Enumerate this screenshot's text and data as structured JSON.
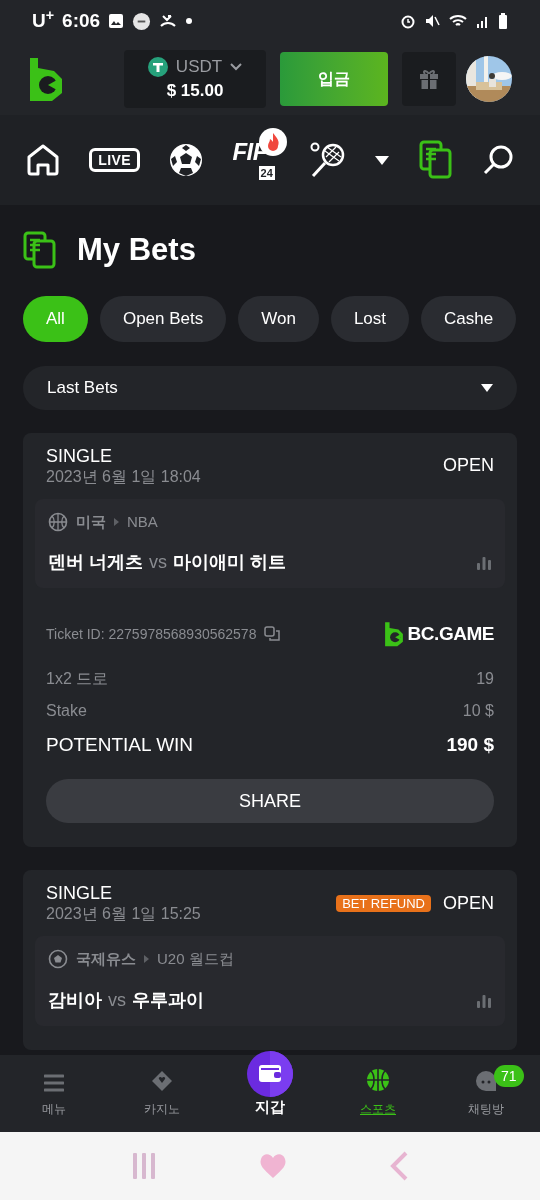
{
  "status_bar": {
    "carrier": "U$^{+}$",
    "time": "6:06"
  },
  "header": {
    "currency": "USDT",
    "balance": "$ 15.00",
    "deposit_button": "입금"
  },
  "sport_nav": [
    {
      "kind": "home",
      "selected": false
    },
    {
      "kind": "live",
      "label": "LIVE",
      "selected": false
    },
    {
      "kind": "soccer",
      "selected": false
    },
    {
      "kind": "fifa",
      "label": "FIF",
      "sub": "24",
      "hot": true,
      "selected": false
    },
    {
      "kind": "tennis",
      "selected": false
    },
    {
      "kind": "more",
      "selected": false
    },
    {
      "kind": "bets",
      "selected": true
    },
    {
      "kind": "search",
      "selected": false
    }
  ],
  "page_title": "My Bets",
  "filters": [
    {
      "label": "All",
      "selected": true
    },
    {
      "label": "Open Bets",
      "selected": false
    },
    {
      "label": "Won",
      "selected": false
    },
    {
      "label": "Lost",
      "selected": false
    },
    {
      "label": "Cashe",
      "selected": false
    }
  ],
  "period_dropdown": "Last Bets",
  "bets": [
    {
      "type": "SINGLE",
      "date": "2023년 6월 1일 18:04",
      "status": "OPEN",
      "kind": "basketball",
      "country": "미국",
      "league": "NBA",
      "home": "덴버 너게츠",
      "vs": "vs",
      "away": "마이애미 히트",
      "ticket": "Ticket ID: 2275978568930562578",
      "brand": "BC.GAME",
      "lines": [
        {
          "label": "1x2 드로",
          "value": "19"
        },
        {
          "label": "Stake",
          "value": "10 $"
        }
      ],
      "potential": {
        "label": "POTENTIAL WIN",
        "value": "190 $"
      },
      "share": "SHARE"
    },
    {
      "type": "SINGLE",
      "date": "2023년 6월 1일 15:25",
      "badge": "BET REFUND",
      "status": "OPEN",
      "kind": "soccer",
      "country": "국제유스",
      "league": "U20 월드컵",
      "home": "감비아",
      "vs": "vs",
      "away": "우루과이"
    }
  ],
  "bottom_nav": [
    {
      "kind": "menu",
      "label": "메뉴",
      "selected": false
    },
    {
      "kind": "casino",
      "label": "카지노",
      "selected": false
    },
    {
      "kind": "wallet",
      "label": "지갑",
      "selected": false
    },
    {
      "kind": "sports",
      "label": "스포츠",
      "selected": true
    },
    {
      "kind": "chat",
      "label": "채팅방",
      "badge": "71",
      "selected": false
    }
  ]
}
